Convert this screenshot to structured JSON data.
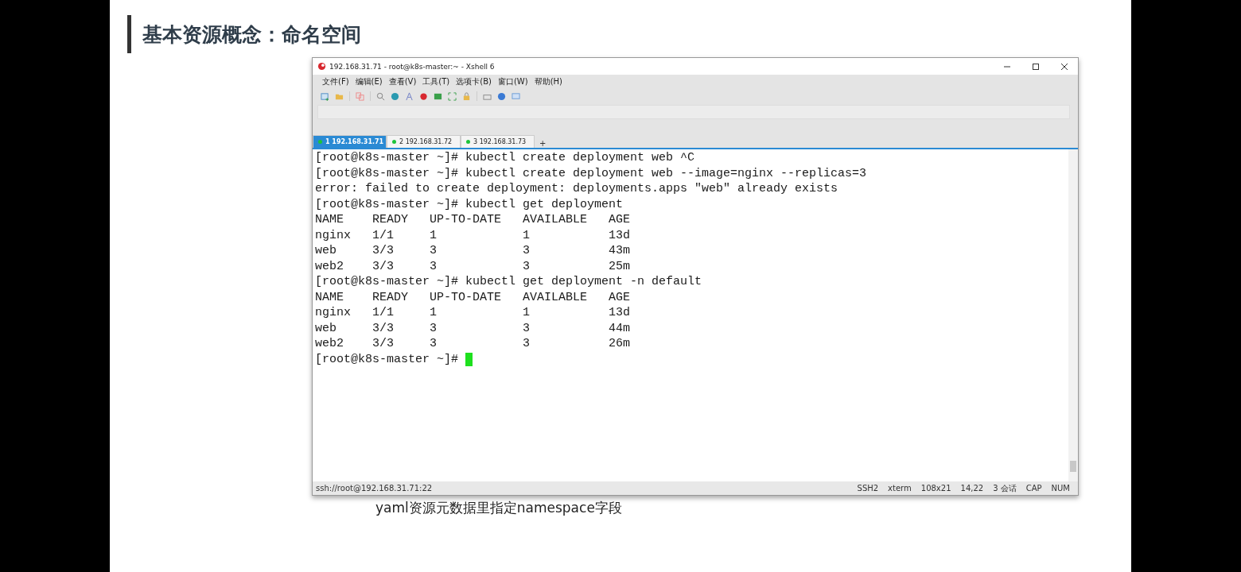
{
  "slide": {
    "title": "基本资源概念：命名空间",
    "bullet": "yaml资源元数据里指定namespace字段"
  },
  "window": {
    "title": "192.168.31.71 - root@k8s-master:~ - Xshell 6",
    "menu": [
      "文件(F)",
      "编辑(E)",
      "查看(V)",
      "工具(T)",
      "选项卡(B)",
      "窗口(W)",
      "帮助(H)"
    ],
    "tabs": [
      {
        "label": "1 192.168.31.71",
        "selected": true
      },
      {
        "label": "2 192.168.31.72",
        "selected": false
      },
      {
        "label": "3 192.168.31.73",
        "selected": false
      }
    ],
    "tab_add": "+",
    "terminal": [
      "[root@k8s-master ~]# kubectl create deployment web ^C",
      "[root@k8s-master ~]# kubectl create deployment web --image=nginx --replicas=3",
      "error: failed to create deployment: deployments.apps \"web\" already exists",
      "[root@k8s-master ~]# kubectl get deployment",
      "NAME    READY   UP-TO-DATE   AVAILABLE   AGE",
      "nginx   1/1     1            1           13d",
      "web     3/3     3            3           43m",
      "web2    3/3     3            3           25m",
      "[root@k8s-master ~]# kubectl get deployment -n default",
      "NAME    READY   UP-TO-DATE   AVAILABLE   AGE",
      "nginx   1/1     1            1           13d",
      "web     3/3     3            3           44m",
      "web2    3/3     3            3           26m",
      "[root@k8s-master ~]# "
    ],
    "status_bar": {
      "address": "ssh://root@192.168.31.71:22",
      "items": [
        "SSH2",
        "xterm",
        "108x21",
        "14,22",
        "3 会话",
        "CAP",
        "NUM"
      ]
    }
  }
}
